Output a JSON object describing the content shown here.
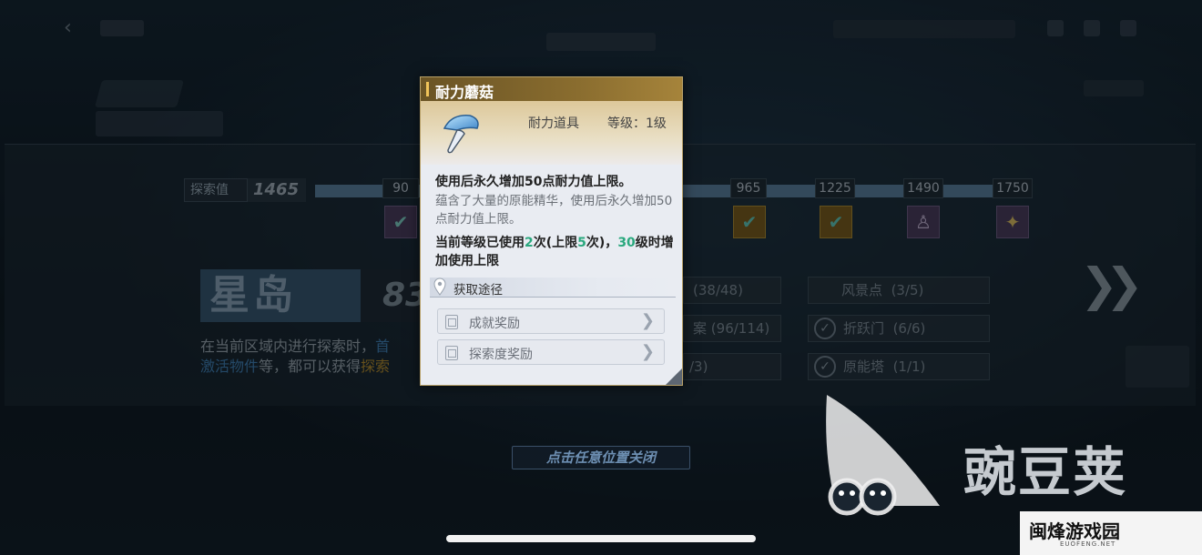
{
  "explore": {
    "label": "探索值",
    "value": "1465",
    "milestones": [
      "90",
      "965",
      "1225",
      "1490",
      "1750"
    ]
  },
  "region": {
    "name": "星岛",
    "percent": "83",
    "desc_part1": "在当前区域内进行探索时，",
    "desc_part2": "首",
    "desc_part3": "激活物件",
    "desc_part4": "等，都可以获得",
    "desc_part5": "探索"
  },
  "stats": {
    "row1_value": "(38/48)",
    "row2_label": "案",
    "row2_value": "(96/114)",
    "row3_value": "/3)",
    "scenery_label": "风景点",
    "scenery_value": "(3/5)",
    "warp_label": "折跃门",
    "warp_value": "(6/6)",
    "tower_label": "原能塔",
    "tower_value": "(1/1)"
  },
  "close_hint": "点击任意位置关闭",
  "popup": {
    "title": "耐力蘑菇",
    "category": "耐力道具",
    "level": "等级：1级",
    "effect": "使用后永久增加50点耐力值上限。",
    "description": "蕴含了大量的原能精华，使用后永久增加50点耐力值上限。",
    "usage_a": "当前等级已使用",
    "usage_used": "2",
    "usage_b": "次(上限",
    "usage_limit": "5",
    "usage_c": "次)，",
    "usage_lv": "30",
    "usage_d": "级时增加使用上限",
    "source_label": "获取途径",
    "sources": [
      "成就奖励",
      "探索度奖励"
    ]
  },
  "watermark": {
    "brand": "豌豆荚",
    "corner": "闽烽游戏园",
    "corner_sub": "EUOFENG.NET"
  },
  "icons": {
    "back": "back-arrow-icon",
    "mushroom": "mushroom-icon",
    "pin": "location-pin-icon",
    "achievement": "document-icon",
    "chevron": "chevron-right-icon",
    "next": "double-chevron-right-icon"
  },
  "colors": {
    "accent_green": "#2aa87e",
    "popup_title_bg": "#8a6d2f",
    "region_bg": "#35546e"
  }
}
